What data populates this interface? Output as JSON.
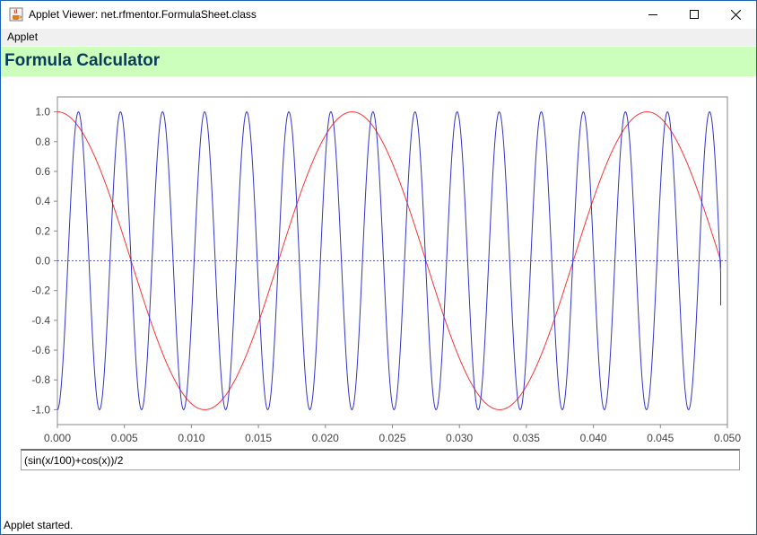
{
  "window": {
    "title": "Applet Viewer: net.rfmentor.FormulaSheet.class",
    "controls": [
      "minimize-icon",
      "maximize-icon",
      "close-icon"
    ]
  },
  "menu": {
    "items": [
      {
        "label": "Applet"
      }
    ]
  },
  "header": {
    "title": "Formula Calculator",
    "background": "#ccffbb",
    "color": "#0b3b5c"
  },
  "formula": {
    "value": "(sin(x/100)+cos(x))/2"
  },
  "status": {
    "text": "Applet started."
  },
  "chart_data": {
    "type": "line",
    "xlim": [
      0,
      0.05
    ],
    "ylim": [
      -1.1,
      1.1
    ],
    "x_ticks": [
      "0.000",
      "0.005",
      "0.010",
      "0.015",
      "0.020",
      "0.025",
      "0.030",
      "0.035",
      "0.040",
      "0.045",
      "0.050"
    ],
    "y_ticks": [
      "1.0",
      "0.8",
      "0.6",
      "0.4",
      "0.2",
      "0.0",
      "-0.2",
      "-0.4",
      "-0.6",
      "-0.8",
      "-1.0"
    ],
    "zero_line": true,
    "series": [
      {
        "color": "#ff3333",
        "x_end": 0.0495,
        "amplitude": 1.0,
        "period": 0.022,
        "phase": "cos",
        "y_end": -0.05
      },
      {
        "color": "#3333cc",
        "x_end": 0.0495,
        "amplitude": 1.0,
        "period": 0.00314,
        "phase": "-cos",
        "y_end": -0.3
      }
    ]
  }
}
